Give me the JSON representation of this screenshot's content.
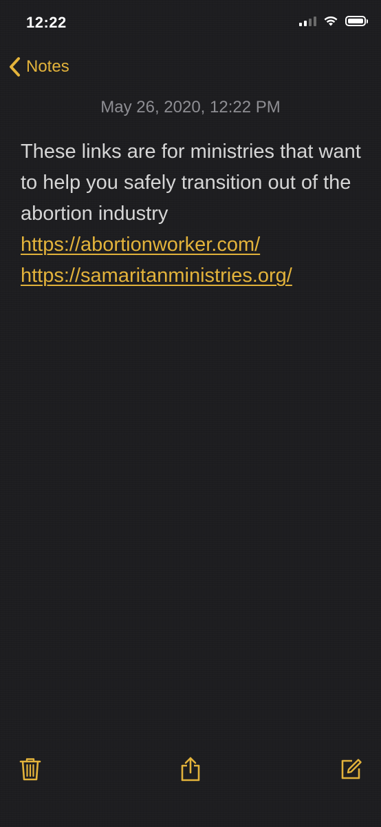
{
  "status_bar": {
    "time": "12:22",
    "signal_bars_active": 2,
    "signal_bars_total": 4,
    "battery_level": 0.8
  },
  "nav": {
    "back_label": "Notes",
    "back_icon": "chevron-left-icon"
  },
  "note": {
    "date": "May 26, 2020, 12:22 PM",
    "text": "These links are for ministries that want to help you safely transition out of the abortion industry",
    "links": [
      "https://abortionworker.com/",
      "https://samaritanministries.org/"
    ]
  },
  "toolbar": {
    "icons": [
      "trash-icon",
      "share-icon",
      "compose-icon"
    ]
  },
  "colors": {
    "accent": "#e3b33b",
    "background": "#1c1c1e",
    "text": "#d6d6d6",
    "secondary_text": "#8e8e93"
  }
}
